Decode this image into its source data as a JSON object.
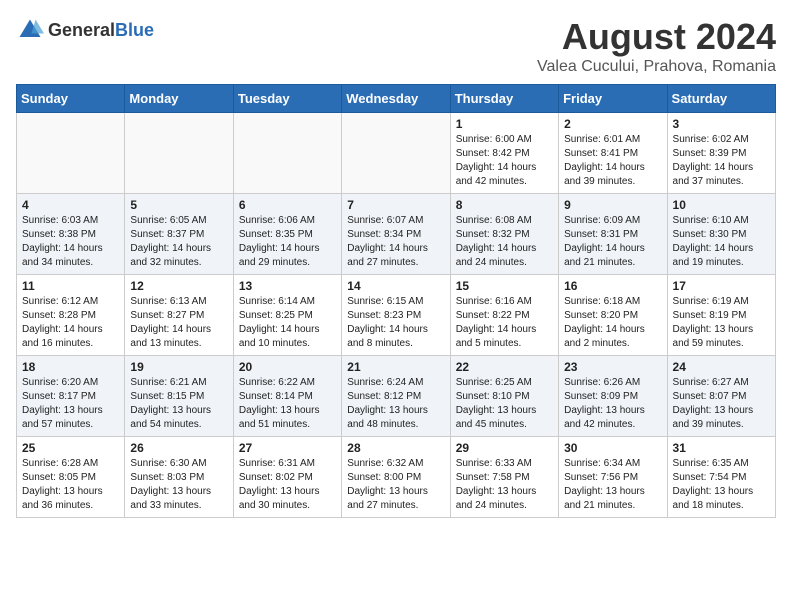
{
  "header": {
    "logo": {
      "general": "General",
      "blue": "Blue"
    },
    "title": "August 2024",
    "location": "Valea Cucului, Prahova, Romania"
  },
  "weekdays": [
    "Sunday",
    "Monday",
    "Tuesday",
    "Wednesday",
    "Thursday",
    "Friday",
    "Saturday"
  ],
  "weeks": [
    [
      {
        "day": "",
        "info": ""
      },
      {
        "day": "",
        "info": ""
      },
      {
        "day": "",
        "info": ""
      },
      {
        "day": "",
        "info": ""
      },
      {
        "day": "1",
        "info": "Sunrise: 6:00 AM\nSunset: 8:42 PM\nDaylight: 14 hours\nand 42 minutes."
      },
      {
        "day": "2",
        "info": "Sunrise: 6:01 AM\nSunset: 8:41 PM\nDaylight: 14 hours\nand 39 minutes."
      },
      {
        "day": "3",
        "info": "Sunrise: 6:02 AM\nSunset: 8:39 PM\nDaylight: 14 hours\nand 37 minutes."
      }
    ],
    [
      {
        "day": "4",
        "info": "Sunrise: 6:03 AM\nSunset: 8:38 PM\nDaylight: 14 hours\nand 34 minutes."
      },
      {
        "day": "5",
        "info": "Sunrise: 6:05 AM\nSunset: 8:37 PM\nDaylight: 14 hours\nand 32 minutes."
      },
      {
        "day": "6",
        "info": "Sunrise: 6:06 AM\nSunset: 8:35 PM\nDaylight: 14 hours\nand 29 minutes."
      },
      {
        "day": "7",
        "info": "Sunrise: 6:07 AM\nSunset: 8:34 PM\nDaylight: 14 hours\nand 27 minutes."
      },
      {
        "day": "8",
        "info": "Sunrise: 6:08 AM\nSunset: 8:32 PM\nDaylight: 14 hours\nand 24 minutes."
      },
      {
        "day": "9",
        "info": "Sunrise: 6:09 AM\nSunset: 8:31 PM\nDaylight: 14 hours\nand 21 minutes."
      },
      {
        "day": "10",
        "info": "Sunrise: 6:10 AM\nSunset: 8:30 PM\nDaylight: 14 hours\nand 19 minutes."
      }
    ],
    [
      {
        "day": "11",
        "info": "Sunrise: 6:12 AM\nSunset: 8:28 PM\nDaylight: 14 hours\nand 16 minutes."
      },
      {
        "day": "12",
        "info": "Sunrise: 6:13 AM\nSunset: 8:27 PM\nDaylight: 14 hours\nand 13 minutes."
      },
      {
        "day": "13",
        "info": "Sunrise: 6:14 AM\nSunset: 8:25 PM\nDaylight: 14 hours\nand 10 minutes."
      },
      {
        "day": "14",
        "info": "Sunrise: 6:15 AM\nSunset: 8:23 PM\nDaylight: 14 hours\nand 8 minutes."
      },
      {
        "day": "15",
        "info": "Sunrise: 6:16 AM\nSunset: 8:22 PM\nDaylight: 14 hours\nand 5 minutes."
      },
      {
        "day": "16",
        "info": "Sunrise: 6:18 AM\nSunset: 8:20 PM\nDaylight: 14 hours\nand 2 minutes."
      },
      {
        "day": "17",
        "info": "Sunrise: 6:19 AM\nSunset: 8:19 PM\nDaylight: 13 hours\nand 59 minutes."
      }
    ],
    [
      {
        "day": "18",
        "info": "Sunrise: 6:20 AM\nSunset: 8:17 PM\nDaylight: 13 hours\nand 57 minutes."
      },
      {
        "day": "19",
        "info": "Sunrise: 6:21 AM\nSunset: 8:15 PM\nDaylight: 13 hours\nand 54 minutes."
      },
      {
        "day": "20",
        "info": "Sunrise: 6:22 AM\nSunset: 8:14 PM\nDaylight: 13 hours\nand 51 minutes."
      },
      {
        "day": "21",
        "info": "Sunrise: 6:24 AM\nSunset: 8:12 PM\nDaylight: 13 hours\nand 48 minutes."
      },
      {
        "day": "22",
        "info": "Sunrise: 6:25 AM\nSunset: 8:10 PM\nDaylight: 13 hours\nand 45 minutes."
      },
      {
        "day": "23",
        "info": "Sunrise: 6:26 AM\nSunset: 8:09 PM\nDaylight: 13 hours\nand 42 minutes."
      },
      {
        "day": "24",
        "info": "Sunrise: 6:27 AM\nSunset: 8:07 PM\nDaylight: 13 hours\nand 39 minutes."
      }
    ],
    [
      {
        "day": "25",
        "info": "Sunrise: 6:28 AM\nSunset: 8:05 PM\nDaylight: 13 hours\nand 36 minutes."
      },
      {
        "day": "26",
        "info": "Sunrise: 6:30 AM\nSunset: 8:03 PM\nDaylight: 13 hours\nand 33 minutes."
      },
      {
        "day": "27",
        "info": "Sunrise: 6:31 AM\nSunset: 8:02 PM\nDaylight: 13 hours\nand 30 minutes."
      },
      {
        "day": "28",
        "info": "Sunrise: 6:32 AM\nSunset: 8:00 PM\nDaylight: 13 hours\nand 27 minutes."
      },
      {
        "day": "29",
        "info": "Sunrise: 6:33 AM\nSunset: 7:58 PM\nDaylight: 13 hours\nand 24 minutes."
      },
      {
        "day": "30",
        "info": "Sunrise: 6:34 AM\nSunset: 7:56 PM\nDaylight: 13 hours\nand 21 minutes."
      },
      {
        "day": "31",
        "info": "Sunrise: 6:35 AM\nSunset: 7:54 PM\nDaylight: 13 hours\nand 18 minutes."
      }
    ]
  ]
}
